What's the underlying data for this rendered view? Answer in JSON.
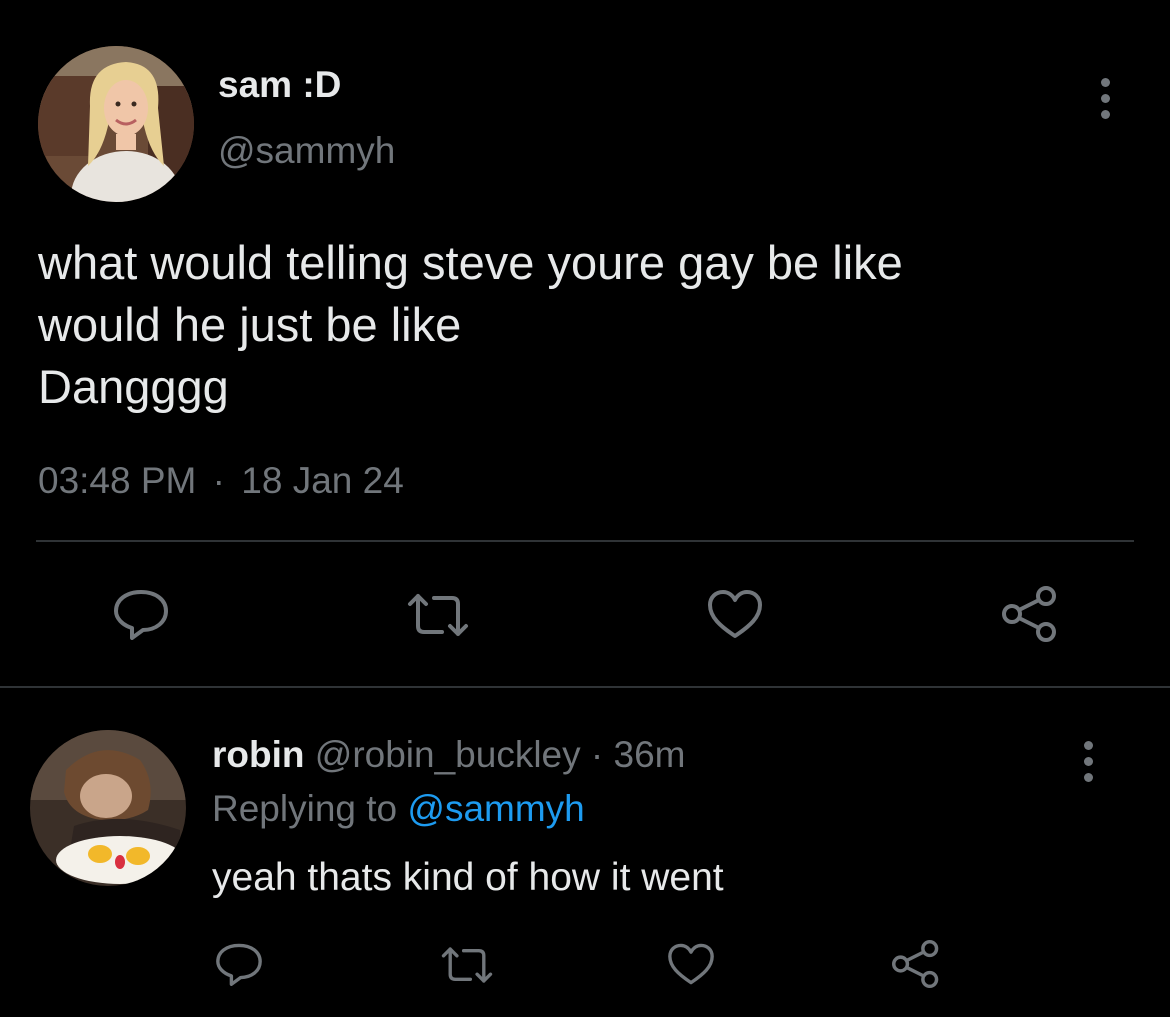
{
  "tweet": {
    "display_name": "sam :D",
    "handle": "@sammyh",
    "text_lines": [
      "what would telling steve youre gay be like",
      "would he just be like",
      "Dangggg"
    ],
    "time": "03:48 PM",
    "separator": "·",
    "date": "18 Jan 24",
    "avatar": "avatar-photo-blonde-smiling"
  },
  "reply": {
    "display_name": "robin",
    "handle": "@robin_buckley",
    "separator": "·",
    "age": "36m",
    "replying_prefix": "Replying to",
    "replying_handle": "@sammyh",
    "text": "yeah thats kind of how it went",
    "avatar": "avatar-photo-with-egg-plate"
  },
  "icons": [
    "more-icon",
    "reply-icon",
    "retweet-icon",
    "like-icon",
    "share-icon"
  ],
  "colors": {
    "background": "#000000",
    "text": "#e7e9ea",
    "muted": "#71767b",
    "link": "#1d9bf0",
    "divider": "#2f3336"
  }
}
